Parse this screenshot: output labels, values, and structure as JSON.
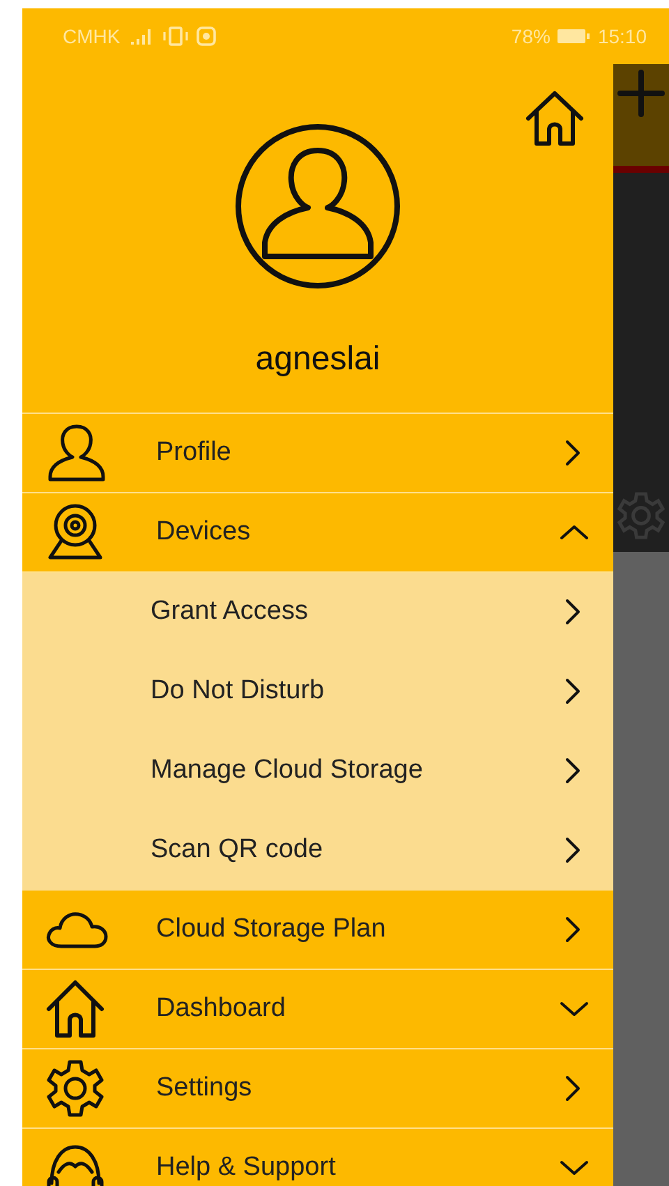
{
  "status_bar": {
    "carrier": "CMHK",
    "battery": "78%",
    "time": "15:10"
  },
  "header": {
    "username": "agneslai"
  },
  "menu": [
    {
      "kind": "link",
      "label": "Profile"
    },
    {
      "kind": "group",
      "label": "Devices",
      "expanded": true,
      "children": [
        {
          "label": "Grant Access"
        },
        {
          "label": "Do Not Disturb"
        },
        {
          "label": "Manage Cloud Storage"
        },
        {
          "label": "Scan QR code"
        }
      ]
    },
    {
      "kind": "link",
      "label": "Cloud Storage Plan"
    },
    {
      "kind": "group",
      "label": "Dashboard",
      "expanded": false
    },
    {
      "kind": "link",
      "label": "Settings"
    },
    {
      "kind": "group",
      "label": "Help & Support",
      "expanded": false
    }
  ]
}
